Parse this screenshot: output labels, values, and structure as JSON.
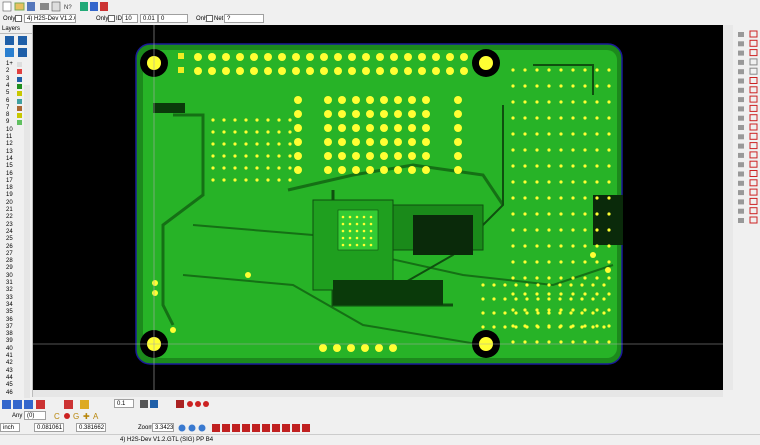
{
  "toolbar": {
    "board_select": "4) H2S-Dev V1.2.G",
    "only_label_1": "Only",
    "only_label_2": "Only",
    "id_label": "ID",
    "id_value": "10",
    "coord_value": "0.01",
    "coord_value_2": "0",
    "only_label_3": "Only",
    "net_label": "Net",
    "net_value": "?"
  },
  "layers_panel": {
    "title": "Layers",
    "rows": [
      "1+",
      "2",
      "3",
      "4",
      "5",
      "6",
      "7",
      "8",
      "9",
      "10",
      "11",
      "12",
      "13",
      "14",
      "15",
      "16",
      "17",
      "18",
      "19",
      "20",
      "21",
      "22",
      "23",
      "24",
      "25",
      "26",
      "27",
      "28",
      "29",
      "30",
      "31",
      "32",
      "33",
      "34",
      "35",
      "36",
      "37",
      "38",
      "39",
      "40",
      "41",
      "42",
      "43",
      "44",
      "45",
      "46"
    ]
  },
  "bottom": {
    "zoom_label": "Zoom",
    "zoom_value": "3.3423",
    "grid_value": "0.1",
    "unit_select": "inch",
    "x_value": "0.081061",
    "y_value": "0.381662",
    "any_label": "Any",
    "any_value": "(0)"
  },
  "status_text": "4) H2S-Dev V1.2.GTL (SIG) PP B4",
  "colors": {
    "board": "#1d8f1d",
    "copper": "#2fc12f",
    "pad": "#ffff33",
    "background": "#000000",
    "outline": "#1a1a99"
  }
}
